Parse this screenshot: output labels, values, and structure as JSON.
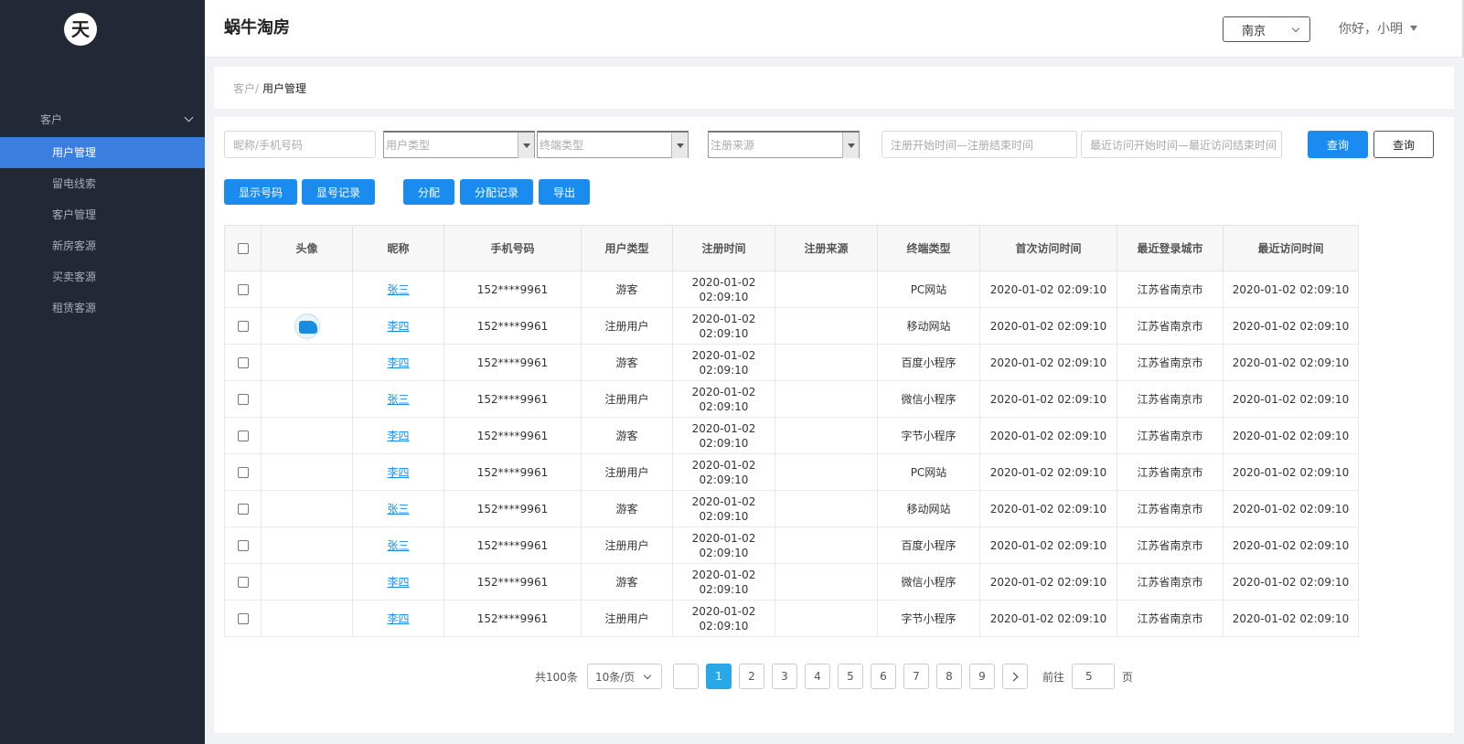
{
  "sidebar": {
    "logo_text": "天",
    "group_label": "客户",
    "items": [
      {
        "label": "用户管理",
        "active": true
      },
      {
        "label": "留电线索",
        "active": false
      },
      {
        "label": "客户管理",
        "active": false
      },
      {
        "label": "新房客源",
        "active": false
      },
      {
        "label": "买卖客源",
        "active": false
      },
      {
        "label": "租赁客源",
        "active": false
      }
    ]
  },
  "header": {
    "title": "蜗牛淘房",
    "city": "南京",
    "greeting": "你好，小明"
  },
  "breadcrumb": {
    "parent": "客户/",
    "current": "用户管理"
  },
  "filters": {
    "keyword_placeholder": "昵称/手机号码",
    "user_type_placeholder": "用户类型",
    "terminal_type_placeholder": "终端类型",
    "register_source_placeholder": "注册来源",
    "register_range_placeholder": "注册开始时间—注册结束时间",
    "visit_range_placeholder": "最近访问开始时间—最近访问结束时间",
    "search_label": "查询",
    "search2_label": "查询"
  },
  "actions": {
    "show_number": "显示号码",
    "number_log": "显号记录",
    "assign": "分配",
    "assign_log": "分配记录",
    "export": "导出"
  },
  "table": {
    "columns": [
      "头像",
      "昵称",
      "手机号码",
      "用户类型",
      "注册时间",
      "注册来源",
      "终端类型",
      "首次访问时间",
      "最近登录城市",
      "最近访问时间"
    ],
    "rows": [
      {
        "avatar": false,
        "nickname": "张三",
        "phone": "152****9961",
        "user_type": "游客",
        "reg_time": "2020-01-02\n02:09:10",
        "reg_source": "",
        "terminal": "PC网站",
        "first_visit": "2020-01-02 02:09:10",
        "city": "江苏省南京市",
        "last_visit": "2020-01-02 02:09:10"
      },
      {
        "avatar": true,
        "nickname": "李四",
        "phone": "152****9961",
        "user_type": "注册用户",
        "reg_time": "2020-01-02\n02:09:10",
        "reg_source": "",
        "terminal": "移动网站",
        "first_visit": "2020-01-02 02:09:10",
        "city": "江苏省南京市",
        "last_visit": "2020-01-02 02:09:10"
      },
      {
        "avatar": false,
        "nickname": "李四",
        "phone": "152****9961",
        "user_type": "游客",
        "reg_time": "2020-01-02\n02:09:10",
        "reg_source": "",
        "terminal": "百度小程序",
        "first_visit": "2020-01-02 02:09:10",
        "city": "江苏省南京市",
        "last_visit": "2020-01-02 02:09:10"
      },
      {
        "avatar": false,
        "nickname": "张三",
        "phone": "152****9961",
        "user_type": "注册用户",
        "reg_time": "2020-01-02\n02:09:10",
        "reg_source": "",
        "terminal": "微信小程序",
        "first_visit": "2020-01-02 02:09:10",
        "city": "江苏省南京市",
        "last_visit": "2020-01-02 02:09:10"
      },
      {
        "avatar": false,
        "nickname": "李四",
        "phone": "152****9961",
        "user_type": "游客",
        "reg_time": "2020-01-02\n02:09:10",
        "reg_source": "",
        "terminal": "字节小程序",
        "first_visit": "2020-01-02 02:09:10",
        "city": "江苏省南京市",
        "last_visit": "2020-01-02 02:09:10"
      },
      {
        "avatar": false,
        "nickname": "李四",
        "phone": "152****9961",
        "user_type": "注册用户",
        "reg_time": "2020-01-02\n02:09:10",
        "reg_source": "",
        "terminal": "PC网站",
        "first_visit": "2020-01-02 02:09:10",
        "city": "江苏省南京市",
        "last_visit": "2020-01-02 02:09:10"
      },
      {
        "avatar": false,
        "nickname": "张三",
        "phone": "152****9961",
        "user_type": "游客",
        "reg_time": "2020-01-02\n02:09:10",
        "reg_source": "",
        "terminal": "移动网站",
        "first_visit": "2020-01-02 02:09:10",
        "city": "江苏省南京市",
        "last_visit": "2020-01-02 02:09:10"
      },
      {
        "avatar": false,
        "nickname": "张三",
        "phone": "152****9961",
        "user_type": "注册用户",
        "reg_time": "2020-01-02\n02:09:10",
        "reg_source": "",
        "terminal": "百度小程序",
        "first_visit": "2020-01-02 02:09:10",
        "city": "江苏省南京市",
        "last_visit": "2020-01-02 02:09:10"
      },
      {
        "avatar": false,
        "nickname": "李四",
        "phone": "152****9961",
        "user_type": "游客",
        "reg_time": "2020-01-02\n02:09:10",
        "reg_source": "",
        "terminal": "微信小程序",
        "first_visit": "2020-01-02 02:09:10",
        "city": "江苏省南京市",
        "last_visit": "2020-01-02 02:09:10"
      },
      {
        "avatar": false,
        "nickname": "李四",
        "phone": "152****9961",
        "user_type": "注册用户",
        "reg_time": "2020-01-02\n02:09:10",
        "reg_source": "",
        "terminal": "字节小程序",
        "first_visit": "2020-01-02 02:09:10",
        "city": "江苏省南京市",
        "last_visit": "2020-01-02 02:09:10"
      }
    ]
  },
  "pagination": {
    "total": "共100条",
    "page_size": "10条/页",
    "pages": [
      "1",
      "2",
      "3",
      "4",
      "5",
      "6",
      "7",
      "8",
      "9"
    ],
    "current_page": "1",
    "goto_label": "前往",
    "goto_value": "5",
    "goto_unit": "页"
  },
  "colors": {
    "sidebar_bg": "#222836",
    "active_menu": "#3a7ee0",
    "primary": "#1a8cf0",
    "page_active": "#29a8e8"
  }
}
